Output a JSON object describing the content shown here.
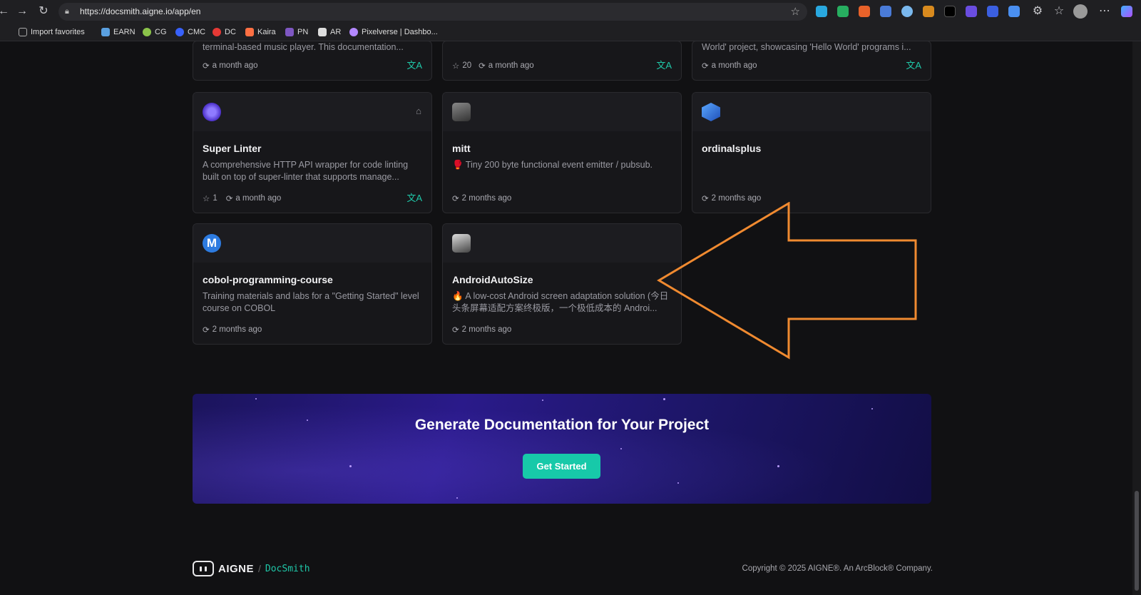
{
  "browser": {
    "url": "https://docsmith.aigne.io/app/en",
    "bookmarks": [
      {
        "label": "Import favorites",
        "color": "#888888"
      },
      {
        "label": "EARN",
        "color": "#5aa0e0"
      },
      {
        "label": "CG",
        "color": "#8bc34a"
      },
      {
        "label": "CMC",
        "color": "#3861fb"
      },
      {
        "label": "DC",
        "color": "#e53935"
      },
      {
        "label": "Kaira",
        "color": "#ff7043"
      },
      {
        "label": "PN",
        "color": "#7e57c2"
      },
      {
        "label": "AR",
        "color": "#dddddd"
      },
      {
        "label": "Pixelverse | Dashbo...",
        "color": "#b388ff"
      }
    ]
  },
  "top_cards": [
    {
      "desc": "terminal-based music player. This documentation...",
      "stars": "",
      "updated": "a month ago",
      "translate": true
    },
    {
      "desc": "",
      "stars": "20",
      "updated": "a month ago",
      "translate": true
    },
    {
      "desc": "World' project, showcasing 'Hello World' programs i...",
      "stars": "",
      "updated": "a month ago",
      "translate": true
    }
  ],
  "cards": [
    {
      "title": "Super Linter",
      "desc": "A comprehensive HTTP API wrapper for code linting built on top of super-linter that supports manage...",
      "stars": "1",
      "updated": "a month ago",
      "translate": true,
      "logo_color": "#5a3fd6"
    },
    {
      "title": "mitt",
      "desc": "🥊 Tiny 200 byte functional event emitter / pubsub.",
      "stars": "",
      "updated": "2 months ago",
      "translate": false,
      "logo_color": "#555555"
    },
    {
      "title": "ordinalsplus",
      "desc": "",
      "stars": "",
      "updated": "2 months ago",
      "translate": false,
      "logo_color": "#2f6fd0"
    },
    {
      "title": "cobol-programming-course",
      "desc": "Training materials and labs for a \"Getting Started\" level course on COBOL",
      "stars": "",
      "updated": "2 months ago",
      "translate": false,
      "logo_color": "#2d7be0"
    },
    {
      "title": "AndroidAutoSize",
      "desc": "🔥 A low-cost Android screen adaptation solution (今日头条屏幕适配方案终极版，一个极低成本的 Androi...",
      "stars": "",
      "updated": "2 months ago",
      "translate": false,
      "logo_color": "#444444"
    }
  ],
  "banner": {
    "headline": "Generate Documentation for Your Project",
    "cta": "Get Started"
  },
  "footer": {
    "brand": "AIGNE",
    "separator": "/",
    "product": "DocSmith",
    "copyright": "Copyright © 2025 AIGNE®. An ArcBlock® Company."
  },
  "annotation": {
    "color": "#f08a30",
    "icon": "arrow-left-icon"
  }
}
